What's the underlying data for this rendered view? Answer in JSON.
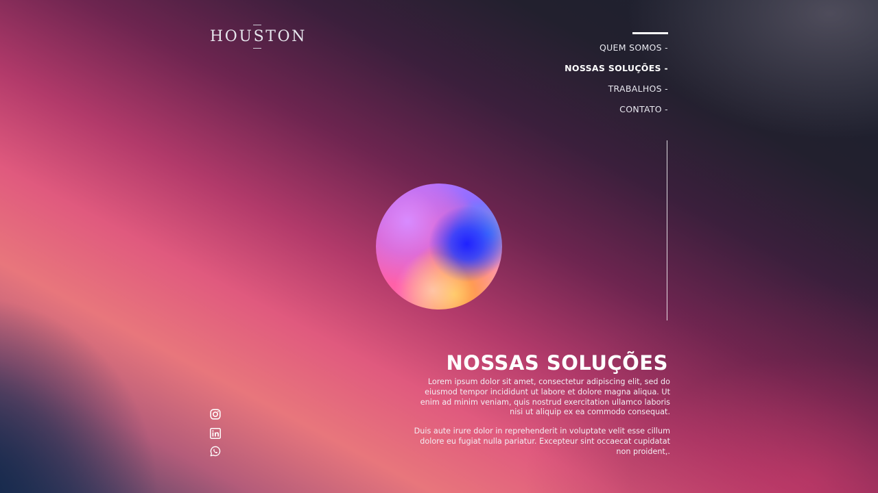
{
  "brand": {
    "logo_text": "HOUSTON"
  },
  "nav": {
    "items": [
      {
        "label": "QUEM SOMOS -",
        "active": false
      },
      {
        "label": "NOSSAS SOLUÇÕES -",
        "active": true
      },
      {
        "label": "TRABALHOS -",
        "active": false
      },
      {
        "label": "CONTATO -",
        "active": false
      }
    ]
  },
  "section": {
    "title": "NOSSAS SOLUÇÕES",
    "paragraph_1": "Lorem ipsum dolor sit amet, consectetur adipiscing elit, sed do eiusmod tempor incididunt ut labore et dolore magna aliqua. Ut enim ad minim veniam, quis nostrud exercitation ullamco laboris nisi ut aliquip ex ea commodo consequat.",
    "paragraph_2": "Duis aute irure dolor in reprehenderit in voluptate velit esse cillum dolore eu fugiat nulla pariatur. Excepteur sint occaecat cupidatat non proident,."
  },
  "social": {
    "icons": [
      "instagram-icon",
      "linkedin-icon",
      "whatsapp-icon"
    ]
  },
  "colors": {
    "accent_text": "#ffffff",
    "background_dark": "#1b2230",
    "gradient_pink": "#e05a7e",
    "gradient_coral": "#e8767c"
  }
}
